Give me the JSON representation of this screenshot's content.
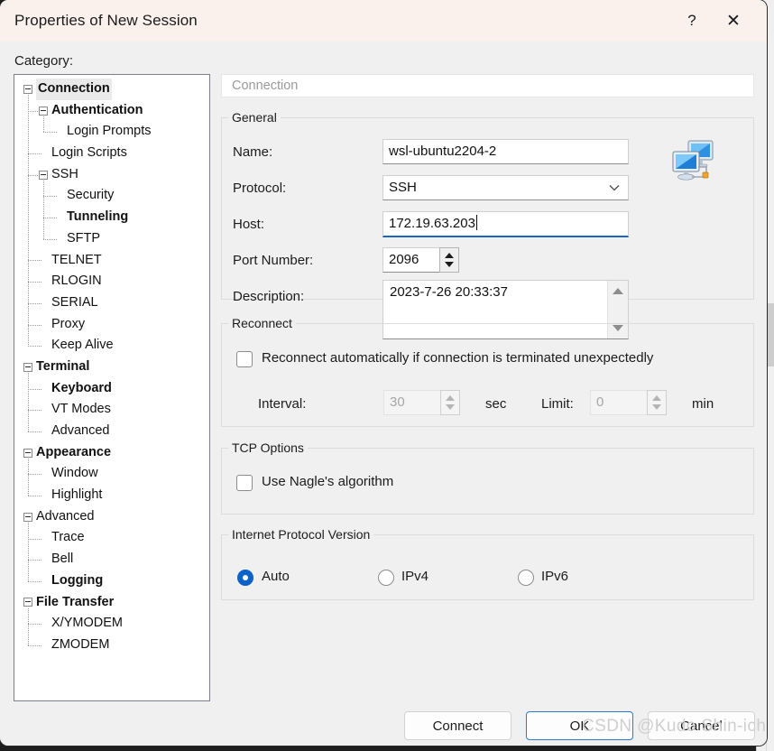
{
  "window": {
    "title": "Properties of New Session",
    "help_label": "?",
    "close_label": "✕"
  },
  "category": {
    "label": "Category:",
    "tree": [
      {
        "label": "Connection",
        "depth": 0,
        "bold": true,
        "expandable": true,
        "selected": true
      },
      {
        "label": "Authentication",
        "depth": 1,
        "bold": true,
        "expandable": true,
        "selected": false
      },
      {
        "label": "Login Prompts",
        "depth": 2,
        "bold": false,
        "expandable": false,
        "selected": false
      },
      {
        "label": "Login Scripts",
        "depth": 1,
        "bold": false,
        "expandable": false,
        "selected": false
      },
      {
        "label": "SSH",
        "depth": 1,
        "bold": false,
        "expandable": true,
        "selected": false
      },
      {
        "label": "Security",
        "depth": 2,
        "bold": false,
        "expandable": false,
        "selected": false
      },
      {
        "label": "Tunneling",
        "depth": 2,
        "bold": true,
        "expandable": false,
        "selected": false
      },
      {
        "label": "SFTP",
        "depth": 2,
        "bold": false,
        "expandable": false,
        "selected": false
      },
      {
        "label": "TELNET",
        "depth": 1,
        "bold": false,
        "expandable": false,
        "selected": false
      },
      {
        "label": "RLOGIN",
        "depth": 1,
        "bold": false,
        "expandable": false,
        "selected": false
      },
      {
        "label": "SERIAL",
        "depth": 1,
        "bold": false,
        "expandable": false,
        "selected": false
      },
      {
        "label": "Proxy",
        "depth": 1,
        "bold": false,
        "expandable": false,
        "selected": false
      },
      {
        "label": "Keep Alive",
        "depth": 1,
        "bold": false,
        "expandable": false,
        "selected": false
      },
      {
        "label": "Terminal",
        "depth": 0,
        "bold": true,
        "expandable": true,
        "selected": false
      },
      {
        "label": "Keyboard",
        "depth": 1,
        "bold": true,
        "expandable": false,
        "selected": false
      },
      {
        "label": "VT Modes",
        "depth": 1,
        "bold": false,
        "expandable": false,
        "selected": false
      },
      {
        "label": "Advanced",
        "depth": 1,
        "bold": false,
        "expandable": false,
        "selected": false
      },
      {
        "label": "Appearance",
        "depth": 0,
        "bold": true,
        "expandable": true,
        "selected": false
      },
      {
        "label": "Window",
        "depth": 1,
        "bold": false,
        "expandable": false,
        "selected": false
      },
      {
        "label": "Highlight",
        "depth": 1,
        "bold": false,
        "expandable": false,
        "selected": false
      },
      {
        "label": "Advanced",
        "depth": 0,
        "bold": false,
        "expandable": true,
        "selected": false
      },
      {
        "label": "Trace",
        "depth": 1,
        "bold": false,
        "expandable": false,
        "selected": false
      },
      {
        "label": "Bell",
        "depth": 1,
        "bold": false,
        "expandable": false,
        "selected": false
      },
      {
        "label": "Logging",
        "depth": 1,
        "bold": true,
        "expandable": false,
        "selected": false
      },
      {
        "label": "File Transfer",
        "depth": 0,
        "bold": true,
        "expandable": true,
        "selected": false
      },
      {
        "label": "X/YMODEM",
        "depth": 1,
        "bold": false,
        "expandable": false,
        "selected": false
      },
      {
        "label": "ZMODEM",
        "depth": 1,
        "bold": false,
        "expandable": false,
        "selected": false
      }
    ]
  },
  "pane": {
    "header": "Connection",
    "general": {
      "legend": "General",
      "name_label": "Name:",
      "name_value": "wsl-ubuntu2204-2",
      "protocol_label": "Protocol:",
      "protocol_value": "SSH",
      "protocol_chevron": "⌄",
      "host_label": "Host:",
      "host_value": "172.19.63.203",
      "port_label": "Port Number:",
      "port_value": "2096",
      "description_label": "Description:",
      "description_value": "2023-7-26 20:33:37",
      "icon_name": "network-computers-icon"
    },
    "reconnect": {
      "legend": "Reconnect",
      "auto_label": "Reconnect automatically if connection is terminated unexpectedly",
      "auto_checked": false,
      "interval_label": "Interval:",
      "interval_value": "30",
      "interval_unit": "sec",
      "limit_label": "Limit:",
      "limit_value": "0",
      "limit_unit": "min"
    },
    "tcp": {
      "legend": "TCP Options",
      "nagle_label": "Use Nagle's algorithm",
      "nagle_checked": false
    },
    "ipver": {
      "legend": "Internet Protocol Version",
      "options": [
        "Auto",
        "IPv4",
        "IPv6"
      ],
      "selected": "Auto"
    }
  },
  "footer": {
    "connect_label": "Connect",
    "ok_label": "OK",
    "cancel_label": "Cancel"
  },
  "watermark": "CSDN @Kudo Shin-ichi",
  "colors": {
    "accent": "#0b63ca",
    "focus_underline": "#1a66c4",
    "titlebar": "#faf1ed",
    "dialog_bg": "#f0f0f0"
  }
}
